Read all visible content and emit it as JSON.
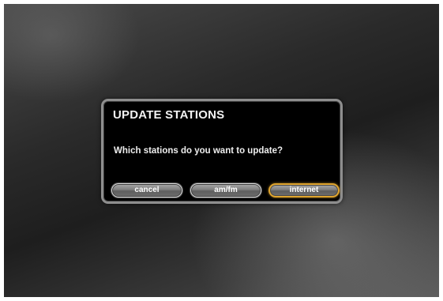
{
  "dialog": {
    "title": "UPDATE STATIONS",
    "message": "Which stations do you want to update?"
  },
  "buttons": {
    "cancel": "cancel",
    "amfm": "am/fm",
    "internet": "internet"
  },
  "focused_button": "internet",
  "colors": {
    "dialog_background": "#000000",
    "dialog_border": "#8e8e8e",
    "focus_ring": "#e0a52e",
    "button_fill": "#7e7e7e",
    "text": "#ffffff"
  }
}
